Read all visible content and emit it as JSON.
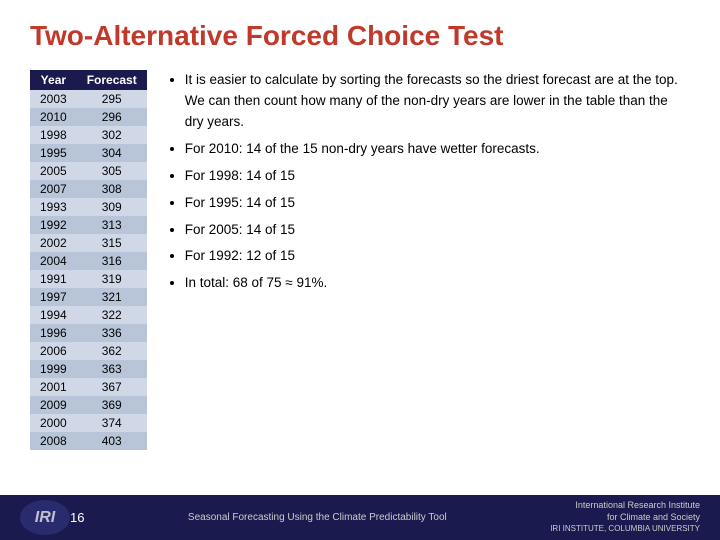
{
  "title": "Two-Alternative Forced Choice Test",
  "table": {
    "headers": [
      "Year",
      "Forecast"
    ],
    "rows": [
      [
        "2003",
        "295"
      ],
      [
        "2010",
        "296"
      ],
      [
        "1998",
        "302"
      ],
      [
        "1995",
        "304"
      ],
      [
        "2005",
        "305"
      ],
      [
        "2007",
        "308"
      ],
      [
        "1993",
        "309"
      ],
      [
        "1992",
        "313"
      ],
      [
        "2002",
        "315"
      ],
      [
        "2004",
        "316"
      ],
      [
        "1991",
        "319"
      ],
      [
        "1997",
        "321"
      ],
      [
        "1994",
        "322"
      ],
      [
        "1996",
        "336"
      ],
      [
        "2006",
        "362"
      ],
      [
        "1999",
        "363"
      ],
      [
        "2001",
        "367"
      ],
      [
        "2009",
        "369"
      ],
      [
        "2000",
        "374"
      ],
      [
        "2008",
        "403"
      ]
    ]
  },
  "bullets": [
    "It is easier to calculate by sorting the forecasts so the driest forecast are at the top. We can then count how many of the non-dry years are lower in the table than the dry years.",
    "For 2010: 14 of the 15 non-dry years have wetter forecasts.",
    "For 1998: 14 of 15",
    "For 1995: 14 of 15",
    "For 2005: 14 of 15",
    "For 1992: 12 of 15",
    "In total: 68 of 75 ≈ 91%."
  ],
  "footer": {
    "page_number": "16",
    "subtitle": "Seasonal Forecasting Using the Climate Predictability Tool",
    "logo_text": "IRI",
    "org_name": "International Research Institute\nfor Climate and Society\nIRI INSTITUTE, COLUMBIA UNIVERSITY"
  }
}
